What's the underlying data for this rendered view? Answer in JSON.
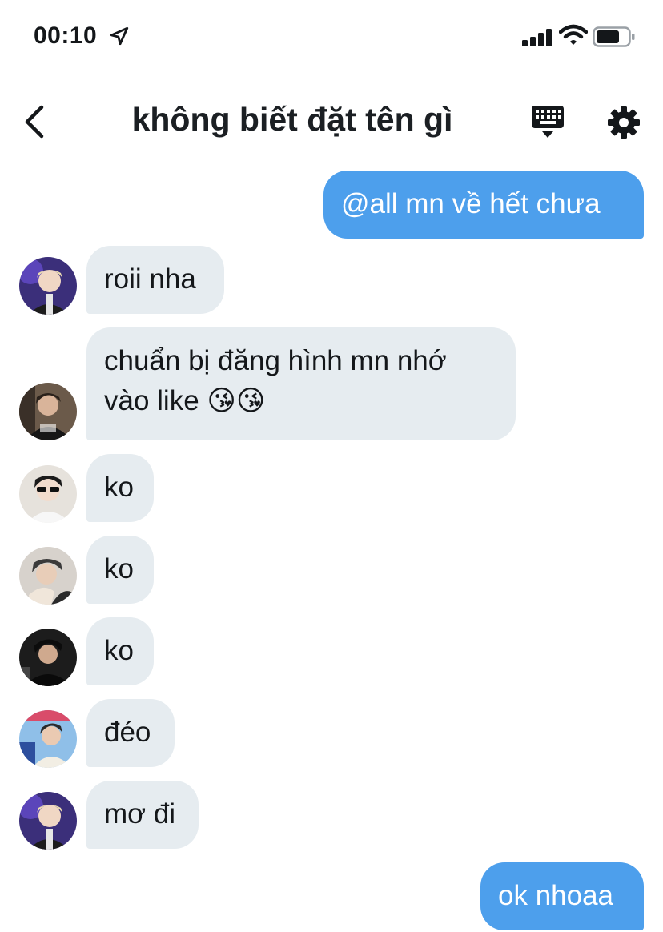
{
  "status_bar": {
    "time": "00:10"
  },
  "header": {
    "title": "không biết đặt tên gì"
  },
  "messages": [
    {
      "side": "out",
      "text": "@all mn về hết chưa"
    },
    {
      "side": "in",
      "text": "roii nha"
    },
    {
      "side": "in",
      "line1": "chuẩn bị đăng hình mn nhớ",
      "line2": "vào like 😘😘"
    },
    {
      "side": "in",
      "text": "ko"
    },
    {
      "side": "in",
      "text": "ko"
    },
    {
      "side": "in",
      "text": "ko"
    },
    {
      "side": "in",
      "text": "đéo"
    },
    {
      "side": "in",
      "text": "mơ đi"
    },
    {
      "side": "out",
      "text": "ok nhoaa"
    }
  ],
  "colors": {
    "outgoing_bubble": "#4d9fec",
    "incoming_bubble": "#e6ecf0",
    "text": "#14171a"
  },
  "icons": [
    "location-arrow-icon",
    "signal-icon",
    "wifi-icon",
    "battery-icon",
    "back-chevron-icon",
    "keyboard-icon",
    "gear-icon"
  ]
}
